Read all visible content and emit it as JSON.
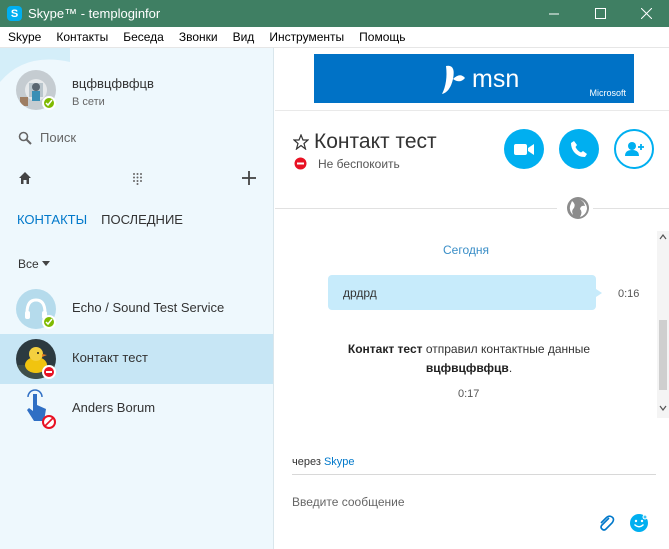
{
  "window": {
    "title": "Skype™ - temploginfor",
    "logo_glyph": "S"
  },
  "menu": [
    "Skype",
    "Контакты",
    "Беседа",
    "Звонки",
    "Вид",
    "Инструменты",
    "Помощь"
  ],
  "profile": {
    "name": "вцфвцфвфцв",
    "status": "В сети"
  },
  "search": {
    "label": "Поиск"
  },
  "tabs": {
    "contacts": "КОНТАКТЫ",
    "recent": "ПОСЛЕДНИЕ"
  },
  "filter": {
    "label": "Все"
  },
  "contacts": [
    {
      "name": "Echo / Sound Test Service",
      "status": "online"
    },
    {
      "name": "Контакт тест",
      "status": "dnd",
      "selected": true
    },
    {
      "name": "Anders Borum",
      "status": "blocked"
    }
  ],
  "ad": {
    "brand": "msn",
    "company": "Microsoft"
  },
  "chat": {
    "title": "Контакт тест",
    "status": "Не беспокоить",
    "date_label": "Сегодня",
    "message": {
      "text": "дрдрд",
      "time": "0:16"
    },
    "system": {
      "sender": "Контакт тест",
      "action": "отправил контактные данные",
      "contact": "вцфвцфвфцв",
      "time": "0:17"
    }
  },
  "composer": {
    "via_prefix": "через",
    "via_link": "Skype",
    "placeholder": "Введите сообщение"
  },
  "colors": {
    "accent": "#00aff0",
    "titlebar": "#3f7f63",
    "sidebar": "#eef8fd",
    "selected": "#c7e6f5",
    "online": "#7fba00",
    "dnd": "#e81123"
  },
  "icons": [
    "search-icon",
    "home-icon",
    "dialpad-icon",
    "plus-icon",
    "star-icon",
    "video-call-icon",
    "phone-icon",
    "add-contact-icon",
    "globe-icon",
    "attach-icon",
    "emoji-icon"
  ]
}
